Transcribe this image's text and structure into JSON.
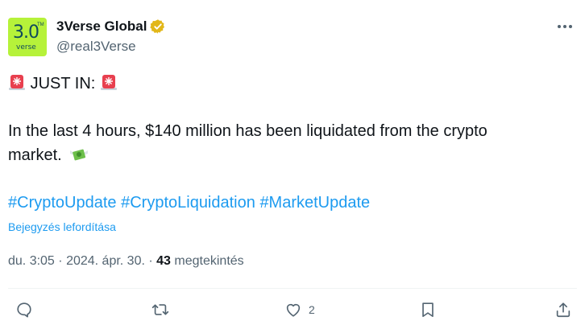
{
  "author": {
    "avatar_text_main": "3.0",
    "avatar_text_tm": "TM",
    "avatar_text_sub": "verse",
    "name": "3Verse Global",
    "handle": "@real3Verse",
    "verified_icon": "verified-badge-gold"
  },
  "tweet": {
    "line1": "JUST IN:",
    "line2": "In the last 4 hours, $140 million has been liquidated from the crypto",
    "line3": "market.",
    "hashtags": [
      "#CryptoUpdate",
      "#CryptoLiquidation",
      "#MarketUpdate"
    ],
    "translate_label": "Bejegyzés lefordítása"
  },
  "meta": {
    "time": "du. 3:05",
    "date": "2024. ápr. 30.",
    "views_count": "43",
    "views_label": "megtekintés"
  },
  "actions": {
    "reply_icon": "reply-icon",
    "retweet_icon": "retweet-icon",
    "like_icon": "heart-icon",
    "like_count": "2",
    "bookmark_icon": "bookmark-icon",
    "share_icon": "share-icon"
  },
  "colors": {
    "link": "#1d9bf0",
    "secondary_text": "#536471",
    "primary_text": "#0f1419",
    "avatar_bg": "#b6f23a"
  }
}
